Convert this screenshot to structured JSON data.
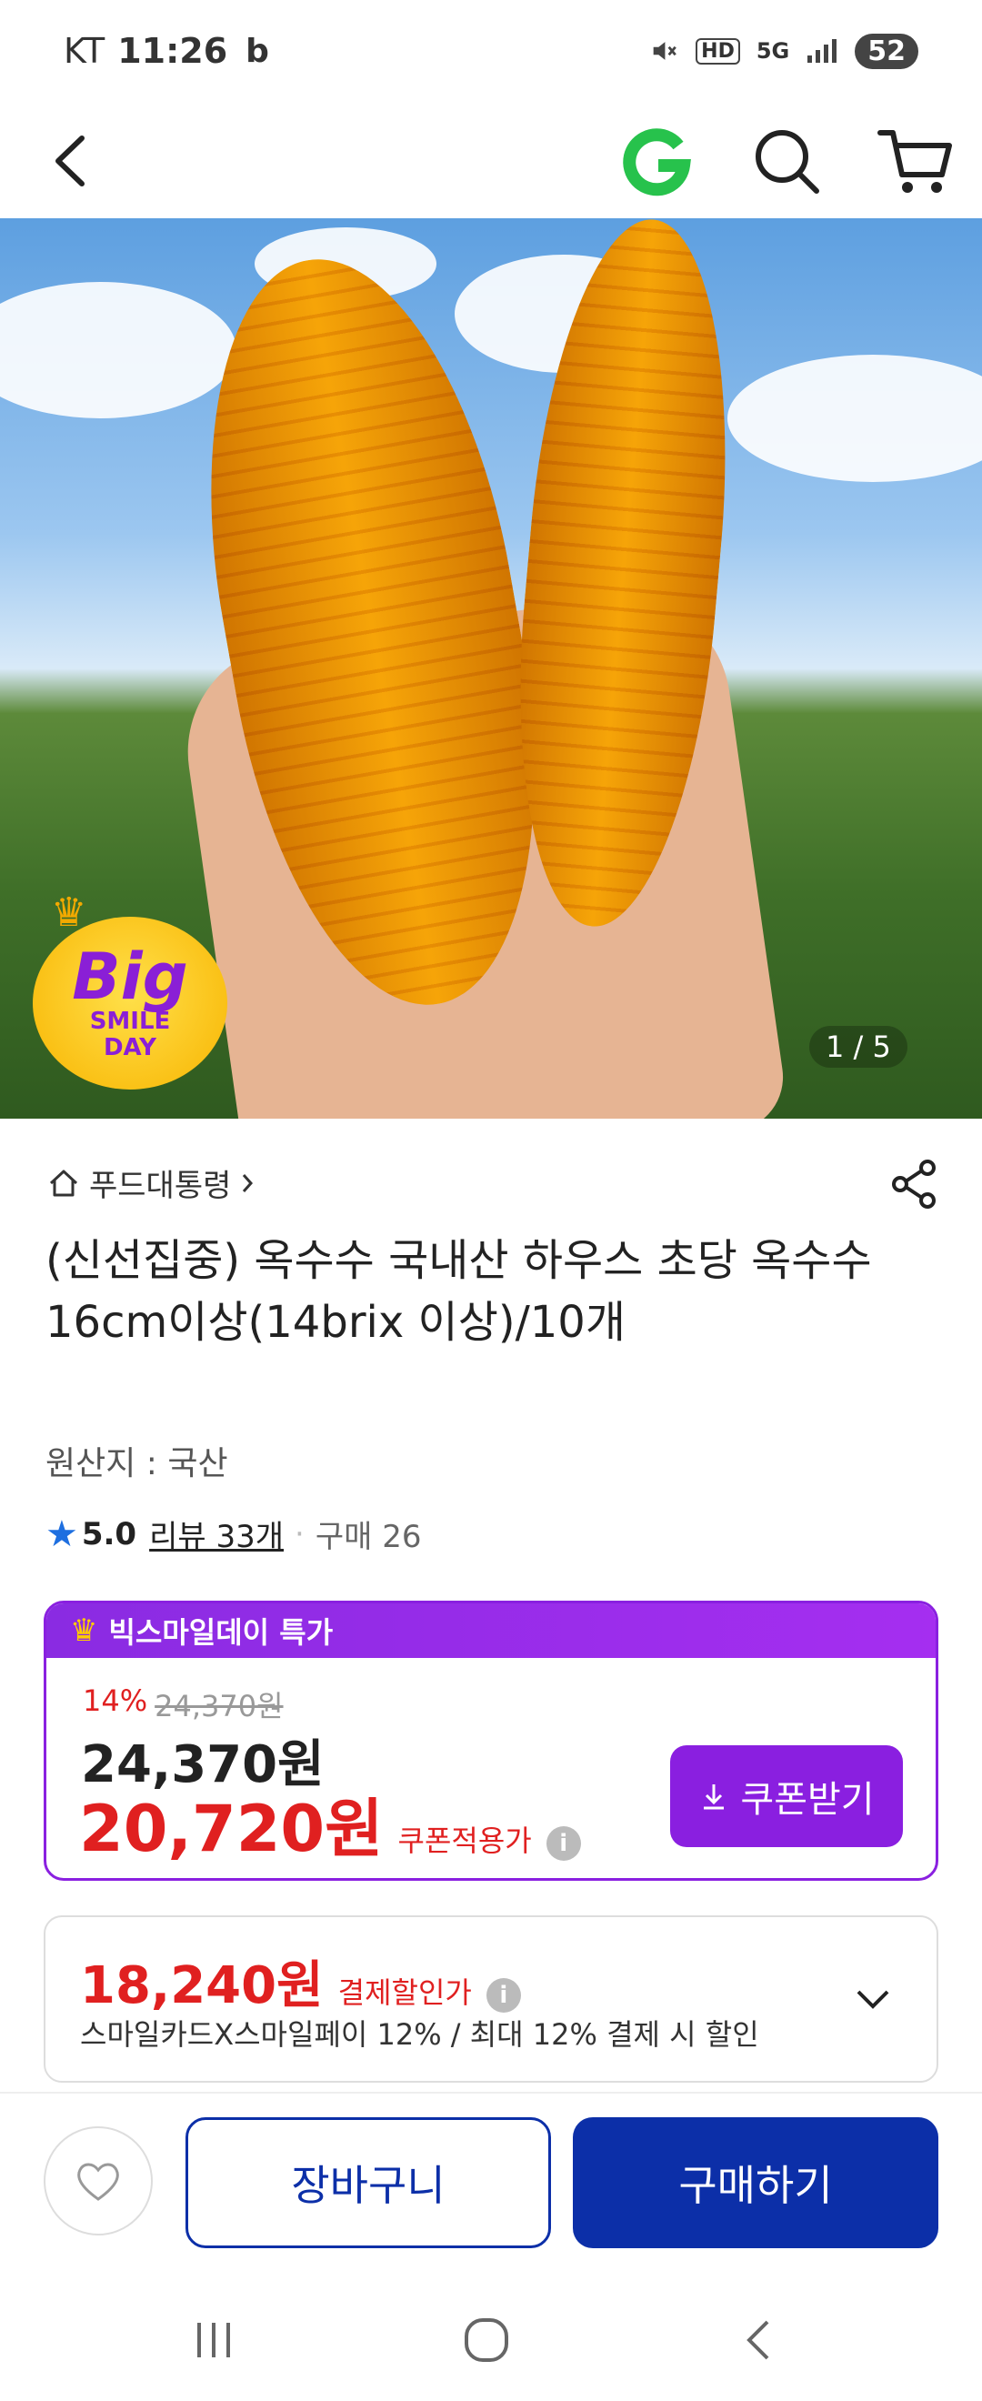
{
  "status_bar": {
    "carrier": "KT",
    "time": "11:26",
    "app_icon": "b",
    "hd": "HD",
    "network": "5G",
    "battery": "52"
  },
  "header": {
    "icons": [
      "back-icon",
      "g-logo-icon",
      "search-icon",
      "cart-icon"
    ],
    "logo_text": "G"
  },
  "hero": {
    "badge_big": "Big",
    "badge_line1": "SMILE",
    "badge_line2": "DAY",
    "pager": "1 / 5"
  },
  "product": {
    "store": "푸드대통령",
    "title": "(신선집중) 옥수수 국내산 하우스 초당 옥수수 16cm이상(14brix 이상)/10개",
    "origin": "원산지 : 국산",
    "rating": "5.0",
    "reviews": "리뷰 33개",
    "purchases": "구매 26"
  },
  "promo": {
    "header": "빅스마일데이 특가",
    "discount_pct": "14%",
    "original_price": "24,370원",
    "price": "24,370원",
    "final_price": "20,720원",
    "coupon_label": "쿠폰적용가",
    "coupon_button": "쿠폰받기"
  },
  "card_discount": {
    "price": "18,240원",
    "label": "결제할인가",
    "description": "스마일카드X스마일페이 12% / 최대 12% 결제 시 할인"
  },
  "bottom_bar": {
    "cart_button": "장바구니",
    "buy_button": "구매하기"
  },
  "colors": {
    "promo_purple": "#8a20e0",
    "price_red": "#e02020",
    "brand_blue": "#0c2fa8",
    "rating_star": "#1e6fe0",
    "g_logo_green": "#27c24c"
  }
}
